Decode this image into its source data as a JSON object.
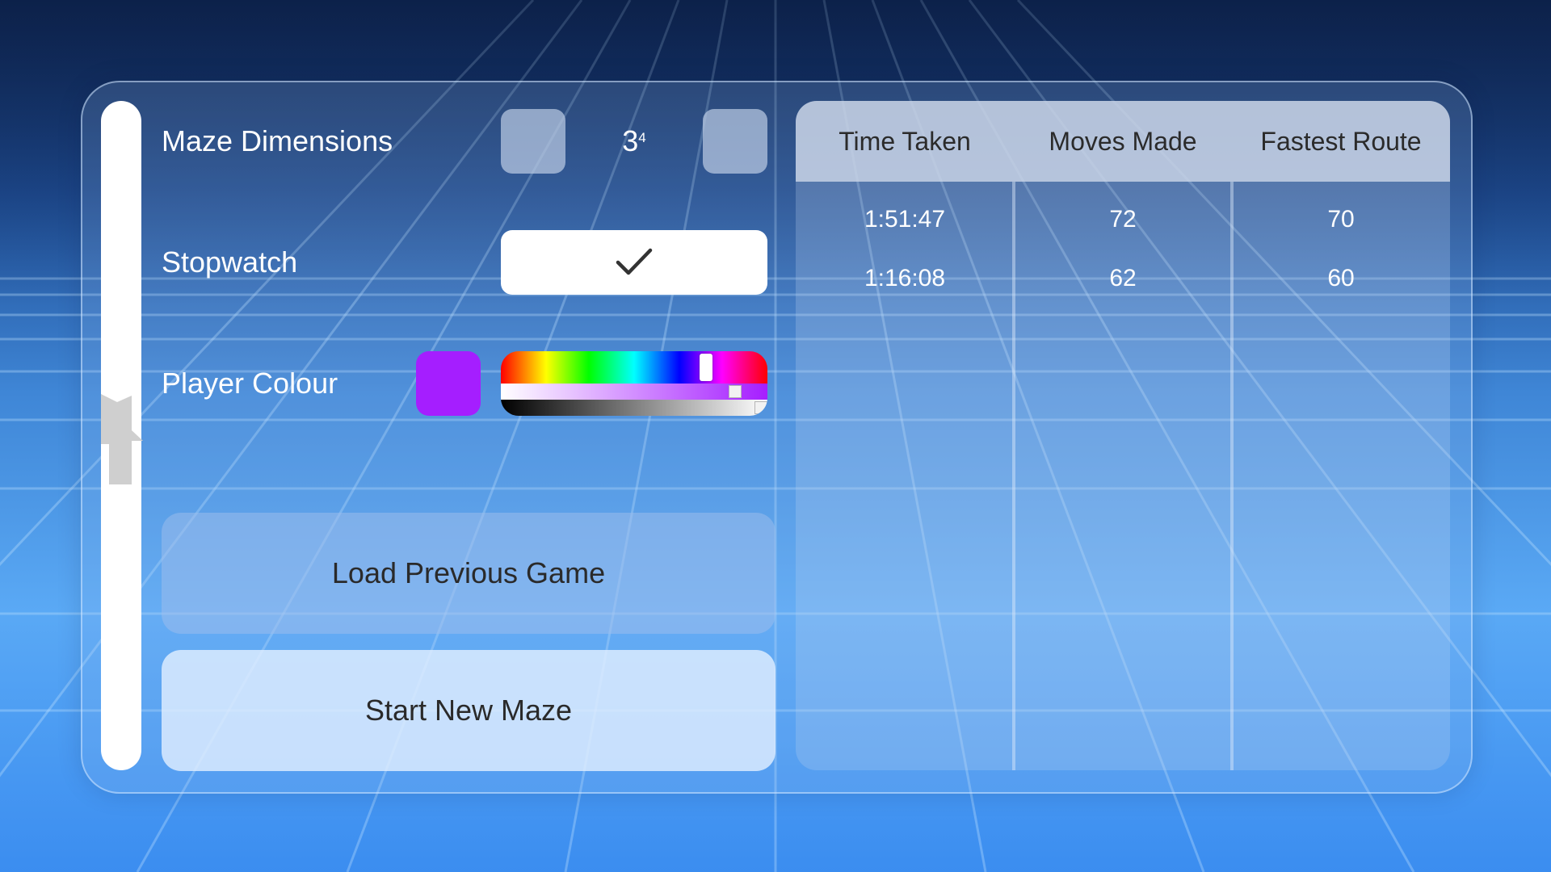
{
  "settings": {
    "maze_dimensions": {
      "label": "Maze Dimensions",
      "base": "3",
      "exponent": "4"
    },
    "stopwatch": {
      "label": "Stopwatch",
      "checked": true
    },
    "player_colour": {
      "label": "Player Colour",
      "color": "#a51eff",
      "hue_fraction": 0.77,
      "saturation_fraction": 0.88,
      "value_fraction": 0.99
    }
  },
  "buttons": {
    "load_previous": "Load Previous Game",
    "start_new": "Start New Maze"
  },
  "results_table": {
    "columns": [
      "Time Taken",
      "Moves Made",
      "Fastest Route"
    ],
    "rows": [
      [
        "1:51:47",
        "72",
        "70"
      ],
      [
        "1:16:08",
        "62",
        "60"
      ]
    ]
  }
}
